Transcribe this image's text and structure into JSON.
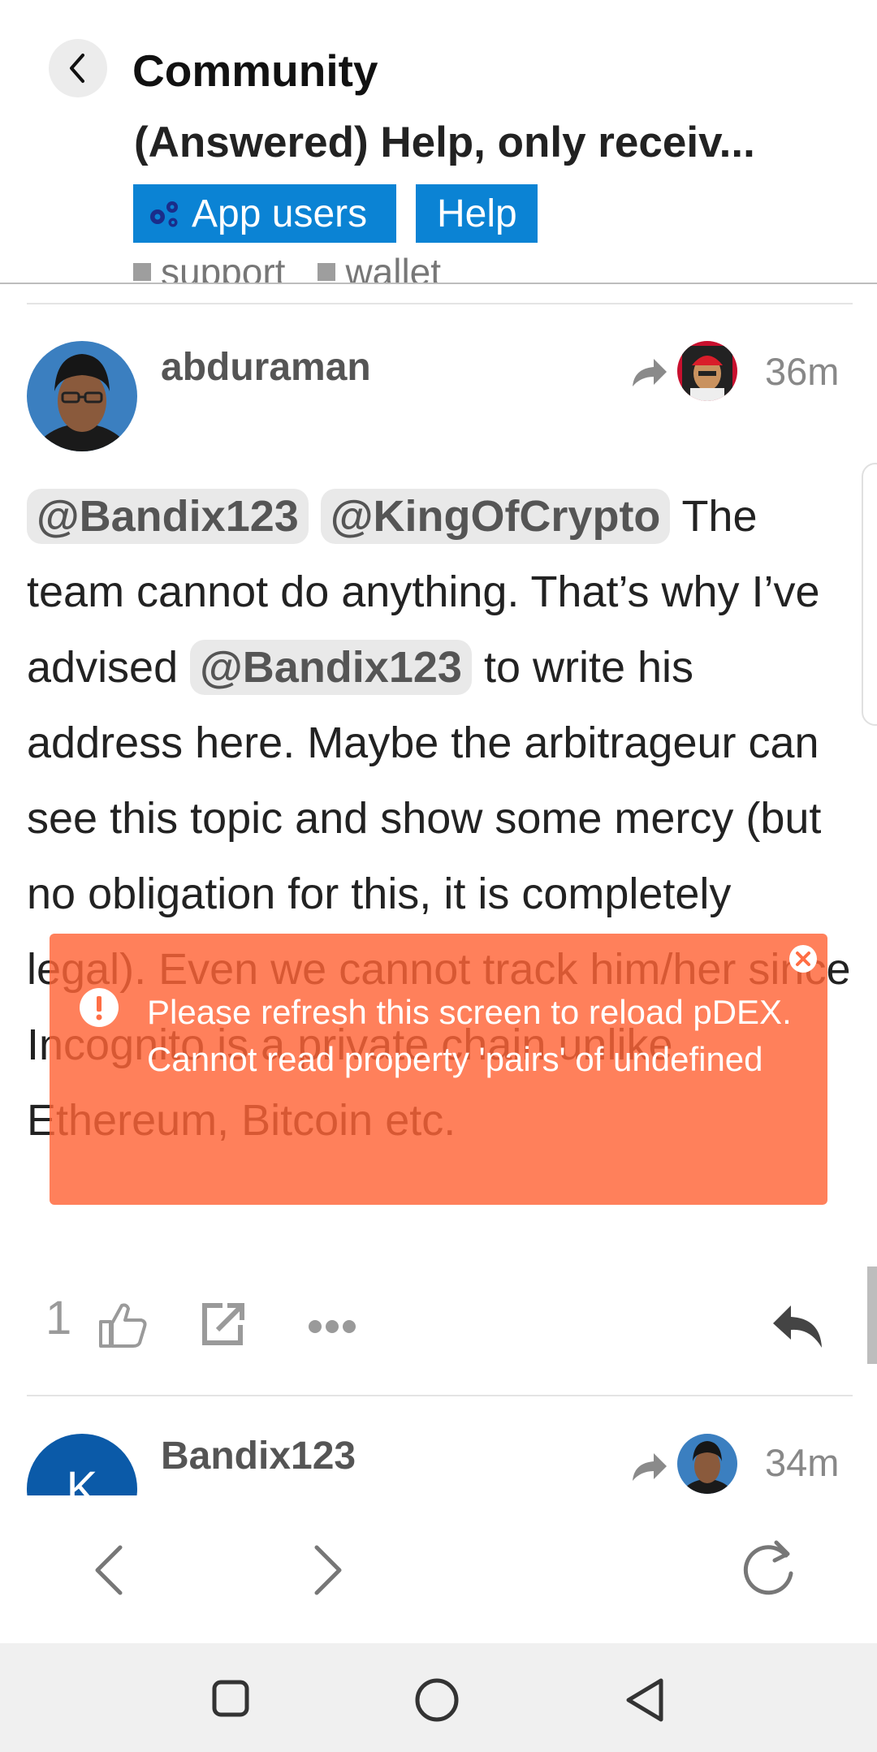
{
  "header": {
    "title": "Community",
    "topic_title": "(Answered) Help, only receiv...",
    "categories": [
      {
        "label": "App users"
      },
      {
        "label": "Help"
      }
    ],
    "tags": [
      "support",
      "wallet"
    ],
    "category_color": "#0b83d4"
  },
  "posts": [
    {
      "username": "abduraman",
      "time": "36m",
      "body_parts": {
        "mention_1": "@Bandix123",
        "mention_2": "@KingOfCrypto",
        "text_1": " The team cannot do anything. That’s why I’ve advised ",
        "mention_3": "@Bandix123",
        "text_2": " to write his address here. Maybe the arbitrageur can see this topic and show some mercy (but no obligation for this, it is completely legal). Even we cannot track him/her since Incognito is a private chain unlike Ethereum, Bitcoin etc."
      },
      "likes": "1"
    },
    {
      "username": "Bandix123",
      "time": "34m",
      "avatar_letter": "K"
    }
  ],
  "toast": {
    "message_line_1": "Please refresh this screen to reload pDEX.",
    "message_line_2": "Cannot read property 'pairs' of undefined",
    "color": "#ff6437"
  }
}
